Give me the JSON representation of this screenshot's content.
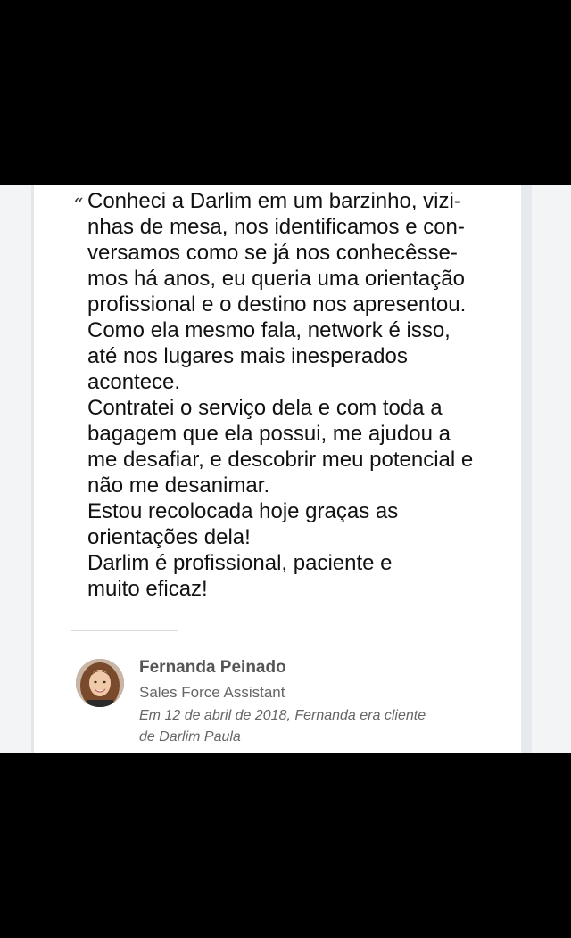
{
  "recommendation": {
    "quote_mark": "“",
    "lines": [
      "Conheci a Darlim em um barzinho, vizi-",
      "nhas de mesa, nos identificamos e con-",
      "versamos como se já nos conhecêsse-",
      "mos há anos, eu queria uma orientação",
      "profissional e o destino nos apresentou.",
      "Como ela mesmo fala, network é isso,",
      "até nos lugares mais inesperados",
      "acontece.",
      "Contratei o serviço dela e com toda a",
      "bagagem que ela possui, me ajudou a",
      "me desafiar, e descobrir meu potencial e",
      "não me desanimar.",
      "Estou recolocada hoje graças as",
      "orientações dela!",
      "Darlim é profissional, paciente e",
      "muito eficaz!"
    ]
  },
  "author": {
    "name": "Fernanda Peinado",
    "role": "Sales Force Assistant",
    "note_lines": [
      "Em 12 de abril de 2018, Fernanda era cliente",
      "de Darlim Paula"
    ],
    "avatar_icon": "profile-photo"
  },
  "colors": {
    "background": "#000000",
    "card": "#ffffff",
    "text": "#111111",
    "muted": "#666666"
  }
}
